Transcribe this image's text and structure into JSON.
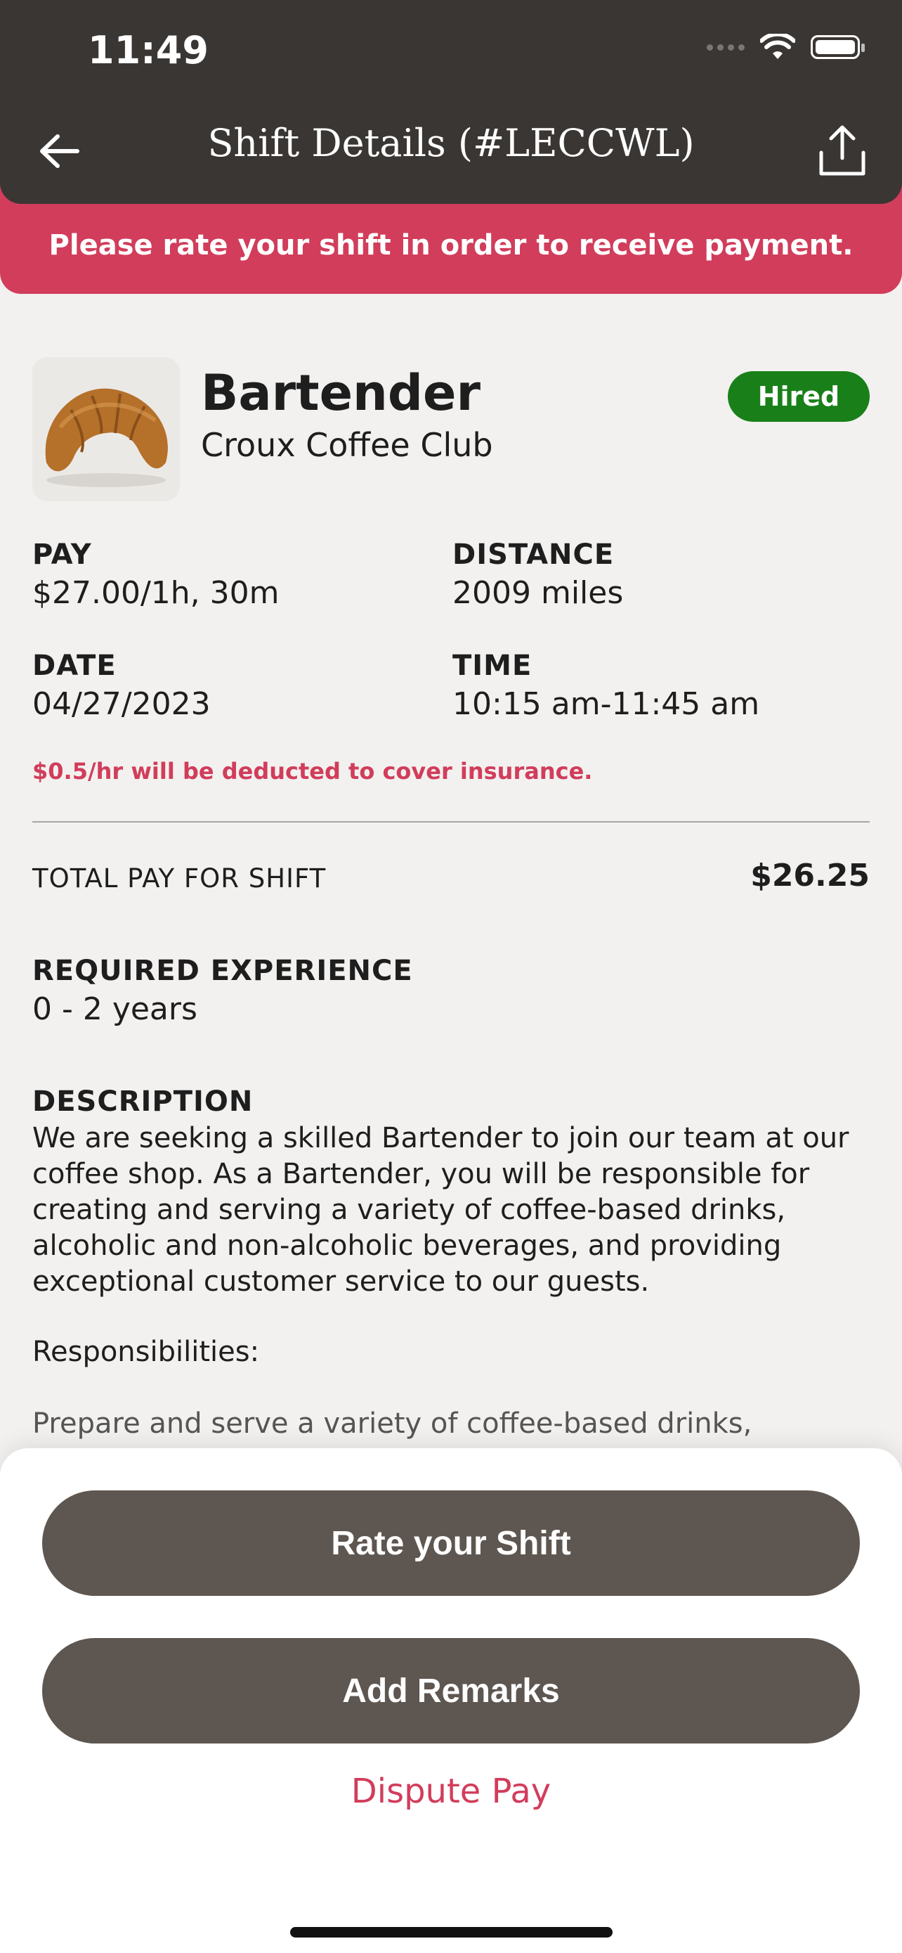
{
  "status_bar": {
    "time": "11:49"
  },
  "header": {
    "title": "Shift Details (#LECCWL)"
  },
  "banner": {
    "text": "Please rate your shift in order to receive payment."
  },
  "job": {
    "title": "Bartender",
    "company": "Croux Coffee Club",
    "status_badge": "Hired",
    "status_color": "#198019"
  },
  "details": {
    "pay_label": "PAY",
    "pay_value": "$27.00/1h, 30m",
    "distance_label": "DISTANCE",
    "distance_value": "2009 miles",
    "date_label": "DATE",
    "date_value": "04/27/2023",
    "time_label": "TIME",
    "time_value": "10:15 am-11:45 am"
  },
  "insurance_note": "$0.5/hr will be deducted to cover insurance.",
  "total": {
    "label": "TOTAL PAY FOR SHIFT",
    "value": "$26.25"
  },
  "experience": {
    "label": "REQUIRED EXPERIENCE",
    "value": "0 - 2 years"
  },
  "description": {
    "label": "DESCRIPTION",
    "text": "We are seeking a skilled Bartender to join our team at our coffee shop. As a Bartender, you will be responsible for creating and serving a variety of coffee-based drinks, alcoholic and non-alcoholic beverages, and providing exceptional customer service to our guests.",
    "responsibilities_label": "Responsibilities:",
    "responsibilities_first": "Prepare and serve a variety of coffee-based drinks,"
  },
  "actions": {
    "rate_label": "Rate your Shift",
    "remarks_label": "Add Remarks",
    "dispute_label": "Dispute Pay"
  },
  "colors": {
    "header_bg": "#3a3633",
    "accent": "#d13d5b",
    "button_bg": "#5e5650"
  },
  "icons": [
    "back-arrow-icon",
    "share-icon",
    "wifi-icon",
    "battery-icon",
    "croissant-image"
  ]
}
